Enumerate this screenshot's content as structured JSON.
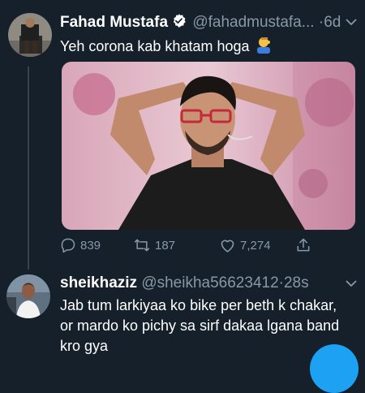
{
  "tweet1": {
    "name": "Fahad Mustafa",
    "handle": "@fahadmustafa...",
    "dot": "·",
    "time": "6d",
    "text": "Yeh corona kab khatam hoga",
    "emoji_icon": "man-facepalming-icon",
    "replies": "839",
    "retweets": "187",
    "likes": "7,274"
  },
  "tweet2": {
    "name": "sheikhaziz",
    "handle": "@sheikha56623412",
    "dot": "·",
    "time": "28s",
    "text_lines": [
      "Jab tum larkiyaa ko bike per beth k chakar,",
      "or mardo ko pichy sa sirf dakaa lgana band",
      "kro gya"
    ]
  },
  "colors": {
    "background": "#15202b",
    "secondary_text": "#8899a6",
    "verified": "#1da1f2",
    "compose_button": "#1da1f2",
    "thread_line": "#38444d"
  }
}
